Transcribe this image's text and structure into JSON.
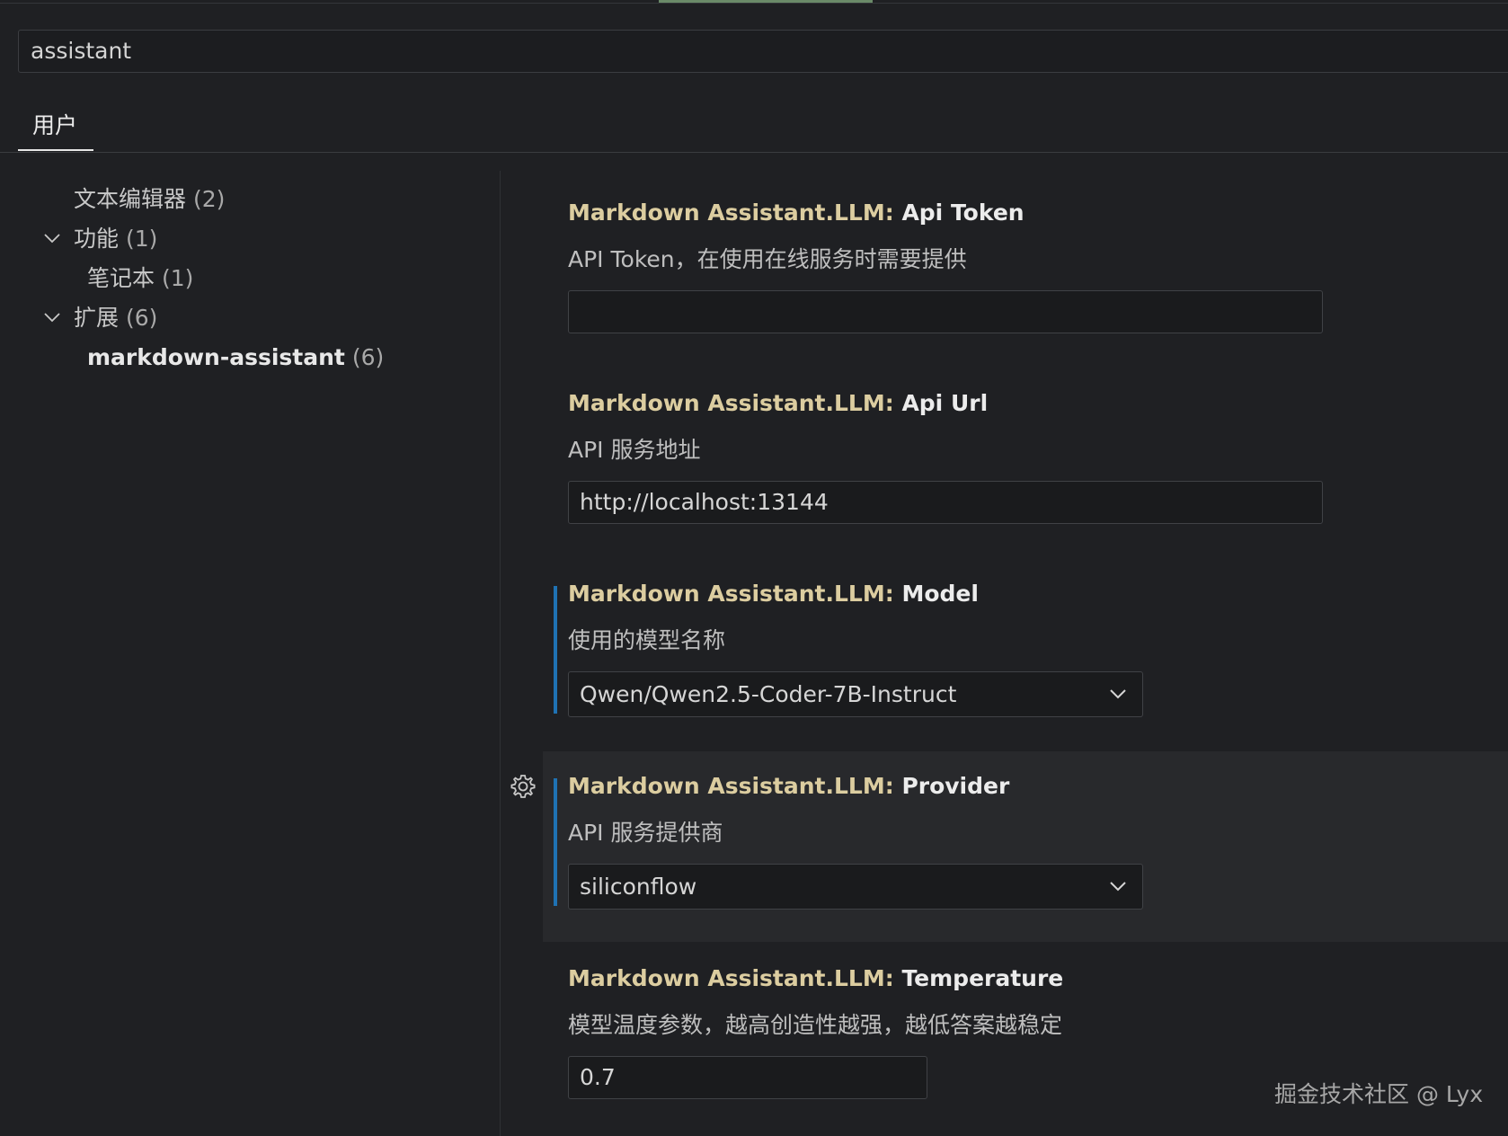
{
  "search": {
    "value": "assistant"
  },
  "tabs": [
    {
      "label": "用户"
    }
  ],
  "toc": [
    {
      "label": "文本编辑器",
      "count": "(2)"
    },
    {
      "label": "功能",
      "count": "(1)"
    },
    {
      "label": "笔记本",
      "count": "(1)"
    },
    {
      "label": "扩展",
      "count": "(6)"
    },
    {
      "label": "markdown-assistant",
      "count": "(6)"
    }
  ],
  "settings": [
    {
      "category": "Markdown Assistant.LLM: ",
      "key": "Api Token",
      "description": "API Token，在使用在线服务时需要提供",
      "control": "text",
      "value": ""
    },
    {
      "category": "Markdown Assistant.LLM: ",
      "key": "Api Url",
      "description": "API 服务地址",
      "control": "text",
      "value": "http://localhost:13144"
    },
    {
      "category": "Markdown Assistant.LLM: ",
      "key": "Model",
      "description": "使用的模型名称",
      "control": "select",
      "value": "Qwen/Qwen2.5-Coder-7B-Instruct",
      "modified": true
    },
    {
      "category": "Markdown Assistant.LLM: ",
      "key": "Provider",
      "description": "API 服务提供商",
      "control": "select",
      "value": "siliconflow",
      "modified": true,
      "focused": true
    },
    {
      "category": "Markdown Assistant.LLM: ",
      "key": "Temperature",
      "description": "模型温度参数，越高创造性越强，越低答案越稳定",
      "control": "text",
      "value": "0.7"
    }
  ],
  "watermark": "掘金技术社区 @ Lyx",
  "colors": {
    "background": "#1f2023",
    "category_text": "#dccda0",
    "modified_indicator": "#1f72b3",
    "tab_underline": "#e6e6e6"
  },
  "icons": {
    "expand": "chevron-down-icon",
    "select": "chevron-down-icon",
    "settings": "gear-icon"
  }
}
